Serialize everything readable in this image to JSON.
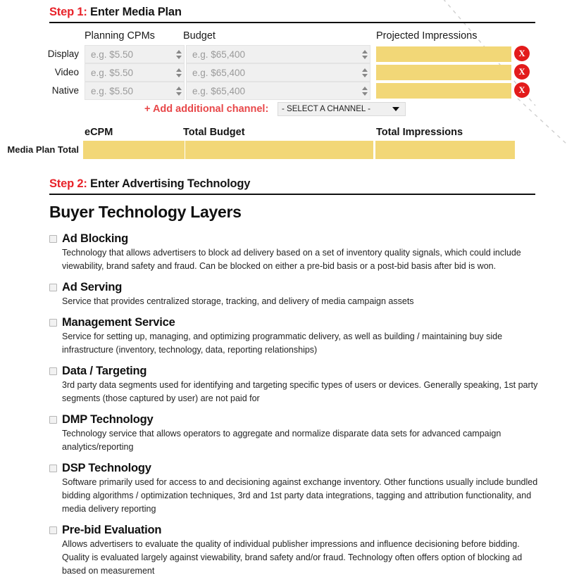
{
  "steps": {
    "one": {
      "num": "Step 1:",
      "title": "Enter Media Plan"
    },
    "two": {
      "num": "Step 2:",
      "title": "Enter Advertising Technology"
    }
  },
  "media_plan": {
    "columns": {
      "cpm": "Planning CPMs",
      "budget": "Budget",
      "impressions": "Projected Impressions"
    },
    "rows": [
      {
        "label": "Display",
        "cpm_placeholder": "e.g. $5.50",
        "budget_placeholder": "e.g. $65,400",
        "impressions_value": "",
        "remove_label": "X"
      },
      {
        "label": "Video",
        "cpm_placeholder": "e.g. $5.50",
        "budget_placeholder": "e.g. $65,400",
        "impressions_value": "",
        "remove_label": "X"
      },
      {
        "label": "Native",
        "cpm_placeholder": "e.g. $5.50",
        "budget_placeholder": "e.g. $65,400",
        "impressions_value": "",
        "remove_label": "X"
      }
    ],
    "add_channel": {
      "label": "+ Add additional channel:",
      "selected": "- SELECT A CHANNEL -"
    },
    "totals": {
      "row_label": "Media Plan Total",
      "columns": {
        "ecpm": "eCPM",
        "budget": "Total Budget",
        "impressions": "Total Impressions"
      },
      "values": {
        "ecpm": "",
        "budget": "",
        "impressions": ""
      }
    }
  },
  "buyer_tech": {
    "title": "Buyer Technology Layers",
    "items": [
      {
        "name": "Ad Blocking",
        "desc": "Technology that allows advertisers to block ad delivery based on a set of inventory quality signals, which could include viewability, brand safety and fraud. Can be blocked on either a pre-bid basis or a post-bid basis after bid is won."
      },
      {
        "name": "Ad Serving",
        "desc": "Service that provides centralized storage, tracking, and delivery of media campaign assets"
      },
      {
        "name": "Management Service",
        "desc": "Service for setting up, managing, and optimizing programmatic delivery, as well as building / maintaining buy side infrastructure (inventory, technology, data, reporting relationships)"
      },
      {
        "name": "Data / Targeting",
        "desc": "3rd party data segments used for identifying and targeting specific types of users or devices. Generally speaking, 1st party segments (those captured by user) are not paid for"
      },
      {
        "name": "DMP Technology",
        "desc": "Technology service that allows operators to aggregate and normalize disparate data sets for advanced campaign analytics/reporting"
      },
      {
        "name": "DSP Technology",
        "desc": "Software primarily used for access to and decisioning against exchange inventory. Other functions usually include bundled bidding algorithms / optimization techniques, 3rd and 1st party data integrations, tagging and attribution functionality, and media delivery reporting"
      },
      {
        "name": "Pre-bid Evaluation",
        "desc": "Allows advertisers to evaluate the quality of individual publisher impressions and influence decisioning before bidding. Quality is evaluated largely against viewability, brand safety and/or fraud. Technology often offers option of blocking ad based on measurement"
      }
    ]
  },
  "colors": {
    "accent_red": "#e8232a",
    "highlight_yellow": "#f2d777",
    "remove_red": "#e31b1b"
  }
}
